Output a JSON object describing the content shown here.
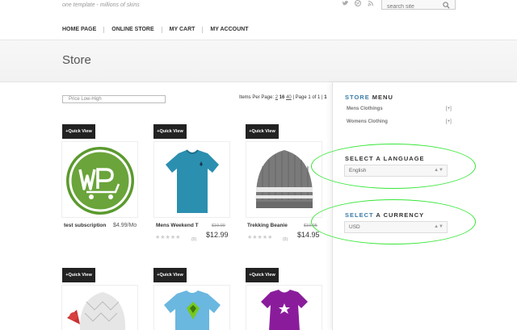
{
  "header": {
    "tagline": "one template - millions of skins",
    "search_placeholder": "search site",
    "social_icons": [
      "twitter-icon",
      "dribbble-icon",
      "rss-icon"
    ]
  },
  "nav": {
    "items": [
      "HOME PAGE",
      "ONLINE STORE",
      "MY CART",
      "MY ACCOUNT"
    ]
  },
  "page": {
    "title": "Store"
  },
  "listing": {
    "sort_value": "Price Low-High",
    "pager": {
      "prefix": "Items Per Page:",
      "per_page_options": [
        "2",
        "16",
        "40"
      ],
      "selected": "16",
      "page_text": "| Page 1 of 1 |",
      "current_page": "1"
    },
    "quick_view_label": "+Quick View",
    "products": [
      {
        "name": "test subscription",
        "price": "$4.99/Mo"
      },
      {
        "name": "Mens Weekend T",
        "old_price": "$19.99",
        "price": "$12.99",
        "rating_count": "(0)"
      },
      {
        "name": "Trekking Beanie",
        "old_price": "$19.95",
        "price": "$14.95",
        "rating_count": "(0)"
      }
    ]
  },
  "sidebar": {
    "menu_title_accent": "STORE",
    "menu_title_rest": "MENU",
    "menu_items": [
      {
        "label": "Mens Clothings",
        "toggle": "[+]"
      },
      {
        "label": "Womens Clothing",
        "toggle": "[+]"
      }
    ],
    "language_title": "SELECT A LANGUAGE",
    "language_value": "English",
    "currency_title_accent": "SELECT",
    "currency_title_rest": "A CURRENCY",
    "currency_value": "USD",
    "caret": "▲▼"
  },
  "colors": {
    "accent": "#3a7ba8",
    "highlight": "#37e637",
    "wp_green": "#6aa43a",
    "tee_teal": "#2b8fb0",
    "tee_light_blue": "#6ab7e0",
    "tee_purple": "#8a1c9c"
  }
}
